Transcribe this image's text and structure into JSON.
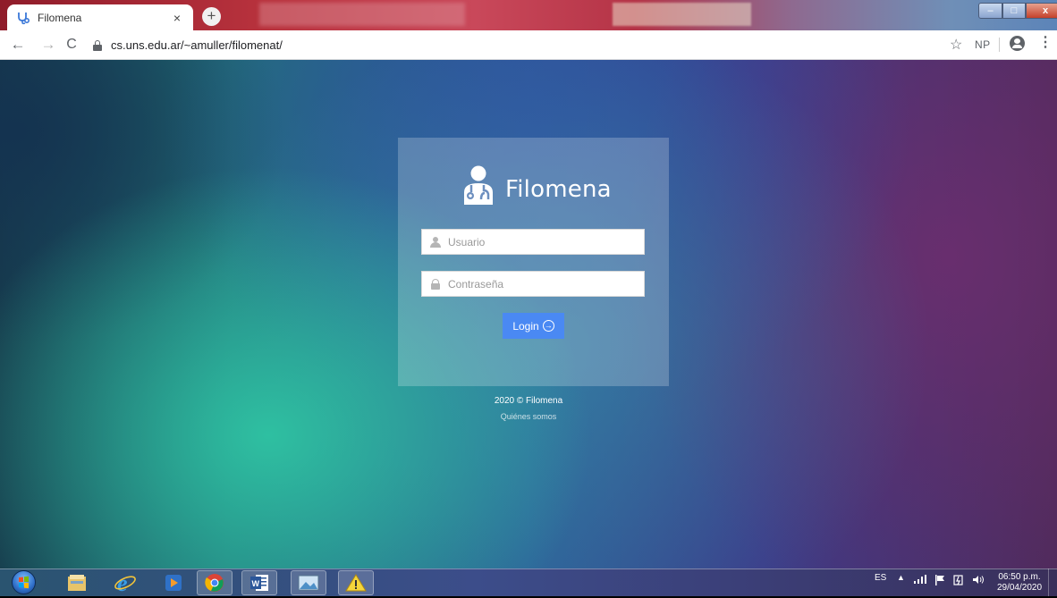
{
  "browser": {
    "tab_title": "Filomena",
    "tab_close": "×",
    "new_tab": "+",
    "url": "cs.uns.edu.ar/~amuller/filomenat/",
    "extension_label": "NP",
    "window_controls": {
      "minimize": "–",
      "maximize": "□",
      "close": "x"
    }
  },
  "login": {
    "brand": "Filomena",
    "username_placeholder": "Usuario",
    "password_placeholder": "Contraseña",
    "login_label": "Login",
    "login_arrow": "→"
  },
  "footer": {
    "copyright": "2020 © Filomena",
    "about_link": "Quiénes somos"
  },
  "taskbar": {
    "language": "ES",
    "time": "06:50 p.m.",
    "date": "29/04/2020"
  },
  "colors": {
    "login_button": "#4a89f3",
    "card_overlay": "rgba(255,255,255,0.22)"
  }
}
